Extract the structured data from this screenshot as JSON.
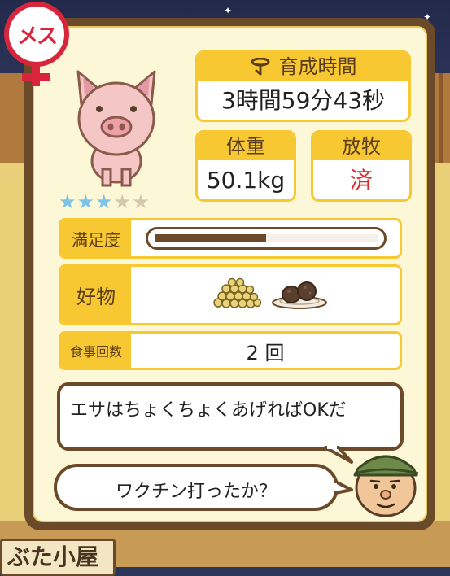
{
  "gender": {
    "label": "メス",
    "color": "#d8253c"
  },
  "pig": {
    "icon": "pig-icon",
    "stars_total": 5,
    "stars_filled": 3
  },
  "growth_time": {
    "label": "育成時間",
    "value": "3時間59分43秒",
    "icon": "timer-icon"
  },
  "weight": {
    "label": "体重",
    "value": "50.1kg"
  },
  "pasture": {
    "label": "放牧",
    "value": "済",
    "value_color": "#e0262e"
  },
  "satisfaction": {
    "label": "満足度",
    "level": 0.5
  },
  "likes": {
    "label": "好物",
    "items": [
      "grain-pile-icon",
      "meat-plate-icon"
    ]
  },
  "meals": {
    "label": "食事回数",
    "value": "2 回"
  },
  "dialogue": {
    "line1": "エサはちょくちょくあげればOKだ",
    "line2": "ワクチン打ったか？"
  },
  "background": {
    "sign_text": "ぶた小屋"
  }
}
